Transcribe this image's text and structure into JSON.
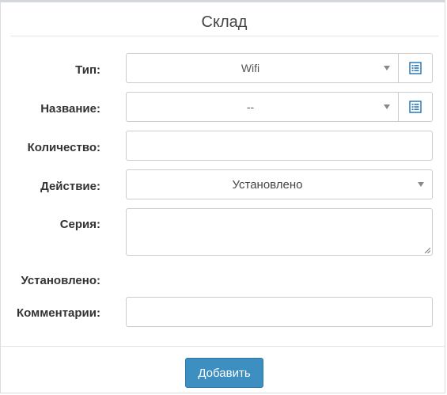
{
  "panel": {
    "title": "Склад"
  },
  "form": {
    "type": {
      "label": "Тип:",
      "value": "Wifi"
    },
    "name": {
      "label": "Название:",
      "value": "--"
    },
    "quantity": {
      "label": "Количество:",
      "value": ""
    },
    "action": {
      "label": "Действие:",
      "value": "Установлено"
    },
    "series": {
      "label": "Серия:",
      "value": ""
    },
    "installed": {
      "label": "Установлено:"
    },
    "comments": {
      "label": "Комментарии:",
      "value": ""
    }
  },
  "footer": {
    "submit_label": "Добавить"
  },
  "icons": {
    "list": "list-icon",
    "caret": "caret-down-icon"
  },
  "colors": {
    "primary_button": "#3d8ec1",
    "icon_blue": "#2a7ab8"
  }
}
